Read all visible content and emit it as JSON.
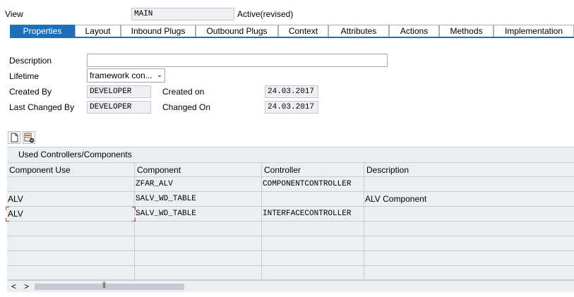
{
  "header": {
    "view_label": "View",
    "view_value": "MAIN",
    "status": "Active(revised)"
  },
  "tabs": [
    {
      "label": "Properties",
      "active": true
    },
    {
      "label": "Layout"
    },
    {
      "label": "Inbound Plugs"
    },
    {
      "label": "Outbound Plugs"
    },
    {
      "label": "Context"
    },
    {
      "label": "Attributes"
    },
    {
      "label": "Actions"
    },
    {
      "label": "Methods"
    },
    {
      "label": "Implementation"
    }
  ],
  "form": {
    "description_label": "Description",
    "description_value": "",
    "lifetime_label": "Lifetime",
    "lifetime_value": "framework con...",
    "created_by_label": "Created By",
    "created_by_value": "DEVELOPER",
    "created_on_label": "Created on",
    "created_on_value": "24.03.2017",
    "last_changed_by_label": "Last Changed By",
    "last_changed_by_value": "DEVELOPER",
    "changed_on_label": "Changed On",
    "changed_on_value": "24.03.2017"
  },
  "toolbar": {
    "icons": [
      "new-document-icon",
      "delete-row-icon"
    ]
  },
  "table": {
    "title": "Used Controllers/Components",
    "columns": [
      "Component Use",
      "Component",
      "Controller",
      "Description"
    ],
    "rows": [
      [
        "",
        "ZFAR_ALV",
        "COMPONENTCONTROLLER",
        ""
      ],
      [
        "ALV",
        "SALV_WD_TABLE",
        "",
        "ALV Component"
      ],
      [
        "ALV",
        "SALV_WD_TABLE",
        "INTERFACECONTROLLER",
        ""
      ],
      [
        "",
        "",
        "",
        ""
      ],
      [
        "",
        "",
        "",
        ""
      ],
      [
        "",
        "",
        "",
        ""
      ],
      [
        "",
        "",
        "",
        ""
      ]
    ]
  },
  "scrollbar": {
    "left_arrow": "<",
    "right_arrow": ">",
    "grip": "|||"
  },
  "colors": {
    "active_tab": "#1f6fb6",
    "field_bg": "#eef0f3",
    "table_bg": "#eceff2"
  }
}
